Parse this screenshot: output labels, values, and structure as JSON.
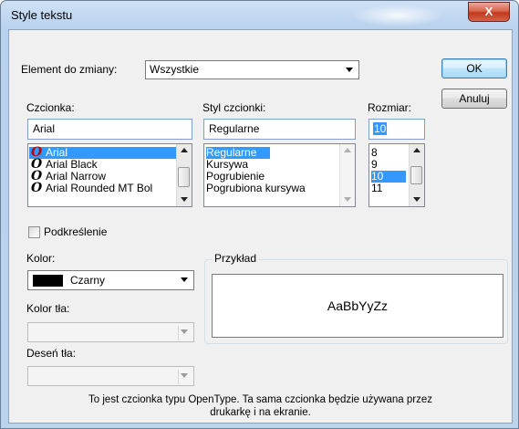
{
  "window": {
    "title": "Style tekstu",
    "close_label": "X"
  },
  "element": {
    "label": "Element do zmiany:",
    "value": "Wszystkie"
  },
  "buttons": {
    "ok": "OK",
    "cancel": "Anuluj"
  },
  "font": {
    "label": "Czcionka:",
    "value": "Arial",
    "items": [
      "Arial",
      "Arial Black",
      "Arial Narrow",
      "Arial Rounded MT Bol"
    ],
    "selected_index": 0
  },
  "style": {
    "label": "Styl czcionki:",
    "value": "Regularne",
    "items": [
      "Regularne",
      "Kursywa",
      "Pogrubienie",
      "Pogrubiona kursywa"
    ],
    "selected_index": 0
  },
  "size": {
    "label": "Rozmiar:",
    "value": "10",
    "items": [
      "8",
      "9",
      "10",
      "11"
    ],
    "selected_index": 2
  },
  "underline": {
    "label": "Podkreślenie",
    "checked": false
  },
  "color": {
    "label": "Kolor:",
    "value": "Czarny",
    "swatch": "#000000"
  },
  "background_color": {
    "label": "Kolor tła:",
    "value": ""
  },
  "background_pattern": {
    "label": "Deseń tła:",
    "value": ""
  },
  "sample": {
    "label": "Przykład",
    "text": "AaBbYyZz"
  },
  "info": {
    "line1": "To jest czcionka typu OpenType. Ta sama czcionka będzie używana przez",
    "line2": "drukarkę i na ekranie."
  },
  "colors": {
    "selection": "#3399ff",
    "titlebar": "#bcd3ec",
    "close": "#c4361b"
  }
}
